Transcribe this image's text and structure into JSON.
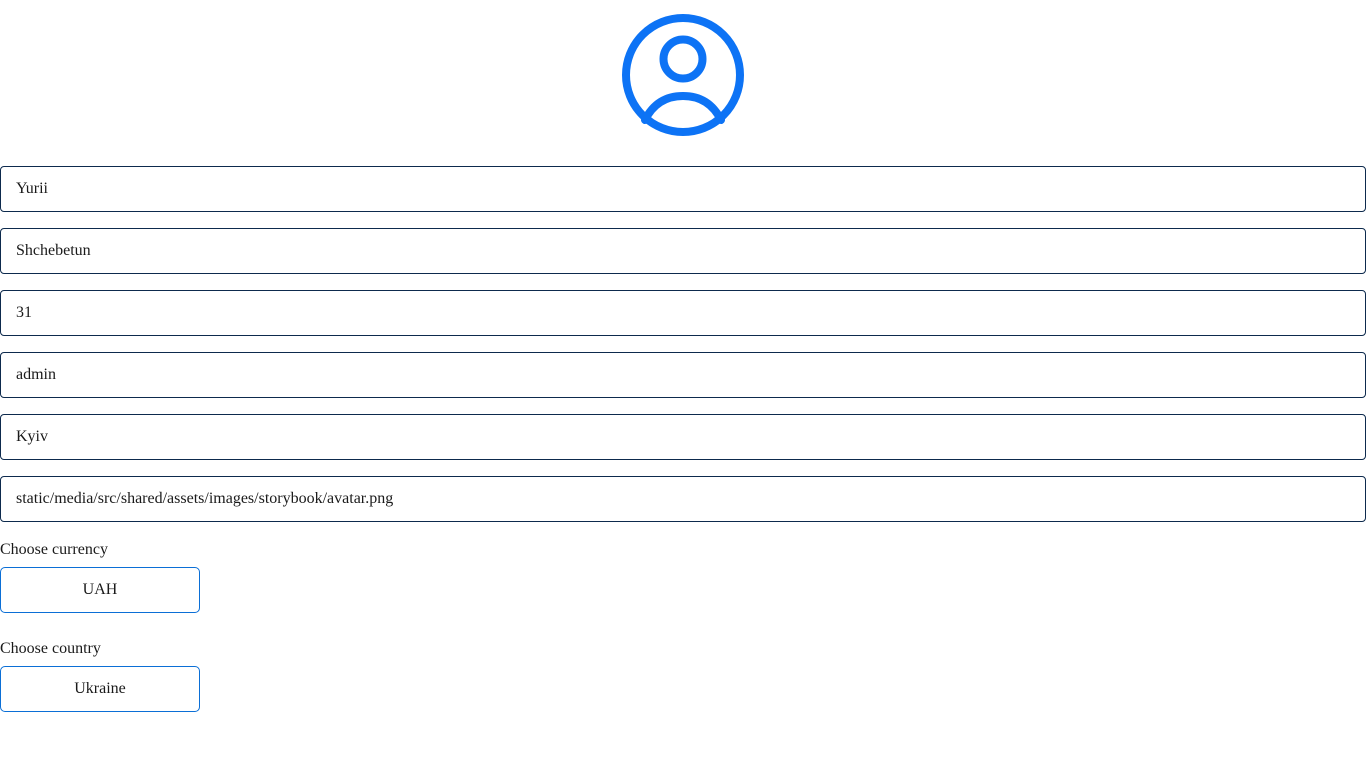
{
  "profile": {
    "avatar_icon": "user-circle-icon",
    "accent_color": "#0d73f5",
    "fields": {
      "first_name": "Yurii",
      "last_name": "Shchebetun",
      "age": "31",
      "username": "admin",
      "city": "Kyiv",
      "avatar_url": "static/media/src/shared/assets/images/storybook/avatar.png"
    },
    "currency": {
      "label": "Choose currency",
      "selected": "UAH"
    },
    "country": {
      "label": "Choose country",
      "selected": "Ukraine"
    }
  }
}
